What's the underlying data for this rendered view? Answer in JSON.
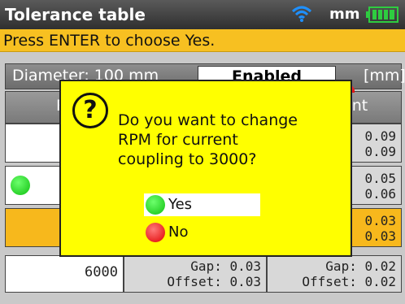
{
  "titlebar": {
    "title": "Tolerance table",
    "unit": "mm",
    "icons": [
      "wifi-icon",
      "battery-icon"
    ],
    "colors": {
      "bg": "#3f3f3f",
      "battery": "#2ecc40",
      "wifi": "#1e90ff"
    }
  },
  "hint": {
    "text": "Press ENTER to choose Yes.",
    "color": "#f7c021"
  },
  "header": {
    "diameter": "Diameter: 100 mm",
    "enabled": "Enabled",
    "unit": "[mm]"
  },
  "columns": {
    "rpm_partial": "R",
    "tolerance_partial": "ent"
  },
  "rows": [
    {
      "rpm": "",
      "col2": "",
      "values": [
        "0.09",
        "0.09"
      ],
      "status": "none"
    },
    {
      "rpm": "",
      "col2": "",
      "values": [
        "0.05",
        "0.06"
      ],
      "status": "green"
    },
    {
      "rpm": "",
      "col2": "",
      "values": [
        "0.03",
        "0.03"
      ],
      "status": "orange"
    }
  ],
  "bottom_row": {
    "rpm": "6000",
    "col2": [
      "Gap: 0.03",
      "Offset: 0.03"
    ],
    "col3": [
      "Gap: 0.02",
      "Offset: 0.02"
    ]
  },
  "dialog": {
    "icon": "question-icon",
    "message": [
      "Do you want to change",
      "RPM for current",
      "coupling to 3000?"
    ],
    "options": [
      {
        "label": "Yes",
        "indicator": "green",
        "selected": true
      },
      {
        "label": "No",
        "indicator": "red",
        "selected": false
      }
    ],
    "colors": {
      "bg": "#ffff00",
      "yes": "#10c010",
      "no": "#e00000"
    }
  }
}
